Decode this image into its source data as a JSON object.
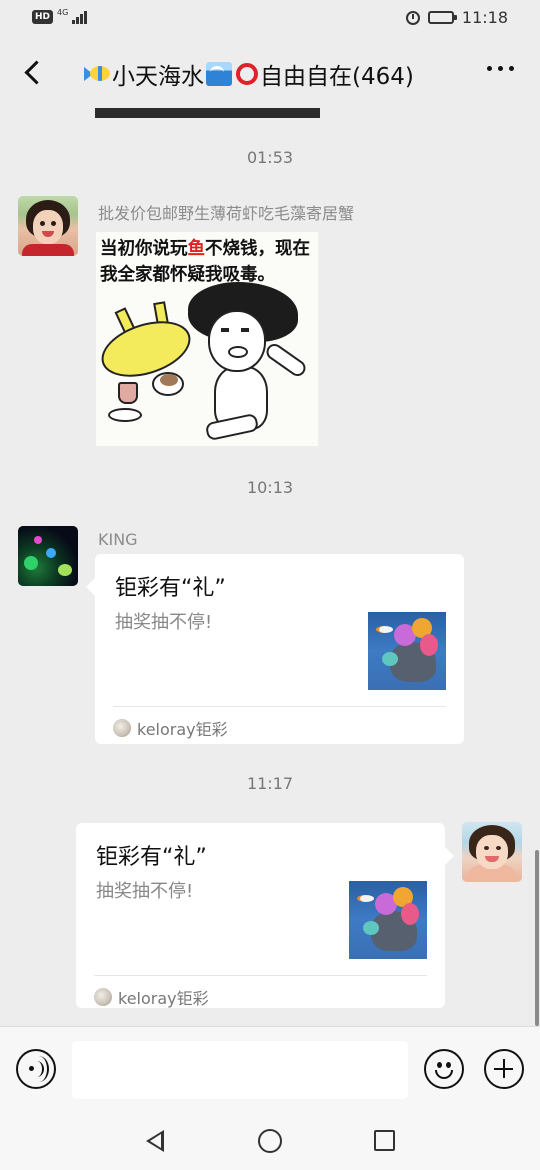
{
  "status_bar": {
    "hd_badge": "HD",
    "network_type": "4G",
    "time": "11:18",
    "icons": [
      "signal-icon",
      "alarm-icon",
      "battery-icon"
    ]
  },
  "header": {
    "title": "小天海水",
    "title_suffix": "自由自在(464)",
    "title_icons": [
      "fish-emoji-icon",
      "wave-emoji-icon",
      "red-circle-emoji-icon"
    ],
    "back_icon": "back-arrow-icon",
    "more_icon": "more-dots-icon"
  },
  "messages": [
    {
      "type": "timestamp",
      "text": "01:53"
    },
    {
      "type": "sticker",
      "side": "left",
      "sender": "批发价包邮野生薄荷虾吃毛藻寄居蟹",
      "caption_parts": [
        "当初你说玩",
        "鱼",
        "不烧钱，现在我全家都怀疑我吸毒。"
      ]
    },
    {
      "type": "timestamp",
      "text": "10:13"
    },
    {
      "type": "link_card",
      "side": "left",
      "sender": "KING",
      "title": "钜彩有“礼”",
      "description": "抽奖抽不停!",
      "source": "keloray钜彩"
    },
    {
      "type": "timestamp",
      "text": "11:17"
    },
    {
      "type": "link_card",
      "side": "right",
      "title": "钜彩有“礼”",
      "description": "抽奖抽不停!",
      "source": "keloray钜彩"
    }
  ],
  "input_bar": {
    "voice_icon": "voice-icon",
    "text_value": "",
    "emoji_icon": "emoji-icon",
    "plus_icon": "plus-icon"
  },
  "system_nav": [
    "nav-back-icon",
    "nav-home-icon",
    "nav-recent-icon"
  ]
}
